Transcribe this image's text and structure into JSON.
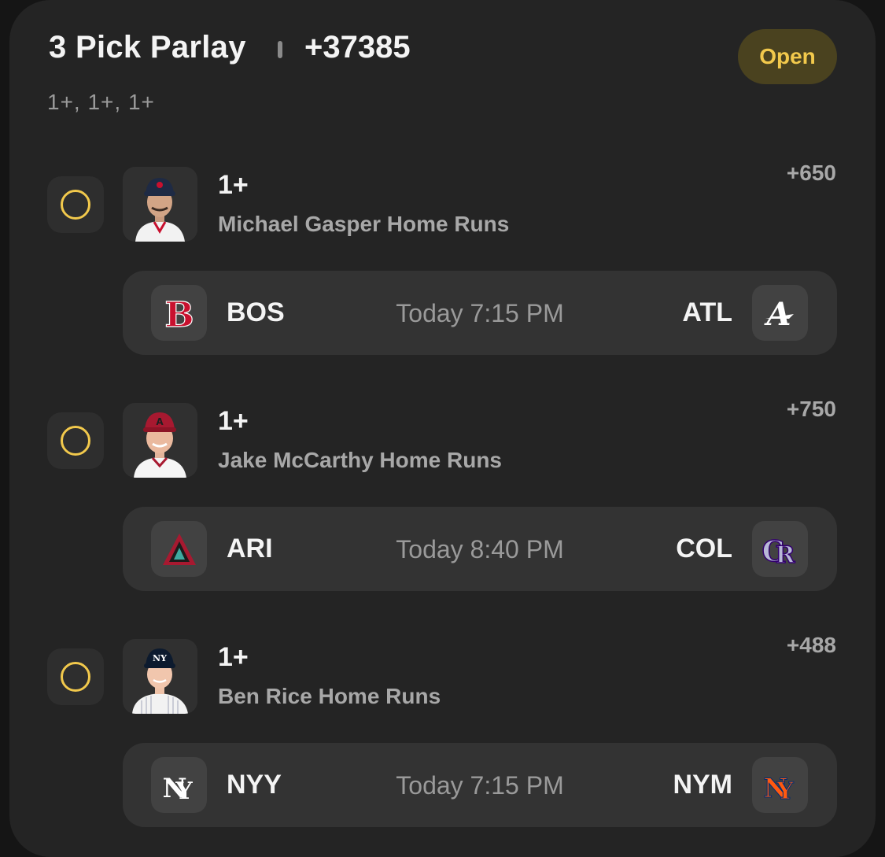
{
  "parlay": {
    "title": "3 Pick Parlay",
    "odds": "+37385",
    "status": "Open",
    "summary": "1+, 1+, 1+"
  },
  "legs": [
    {
      "line": "1+",
      "prop": "Michael Gasper Home Runs",
      "odds": "+650",
      "game": {
        "home": "BOS",
        "away": "ATL",
        "time": "Today 7:15 PM"
      },
      "home_logo_icon": "red-sox-logo-icon",
      "away_logo_icon": "braves-logo-icon",
      "cap_color": "#1e2a44"
    },
    {
      "line": "1+",
      "prop": "Jake McCarthy Home Runs",
      "odds": "+750",
      "game": {
        "home": "ARI",
        "away": "COL",
        "time": "Today 8:40 PM"
      },
      "home_logo_icon": "diamondbacks-logo-icon",
      "away_logo_icon": "rockies-logo-icon",
      "cap_color": "#a71930"
    },
    {
      "line": "1+",
      "prop": "Ben Rice Home Runs",
      "odds": "+488",
      "game": {
        "home": "NYY",
        "away": "NYM",
        "time": "Today 7:15 PM"
      },
      "home_logo_icon": "yankees-logo-icon",
      "away_logo_icon": "mets-logo-icon",
      "cap_color": "#0c1a2e"
    }
  ],
  "colors": {
    "accent_yellow": "#f2c94c",
    "card_bg": "#242424",
    "game_bg": "#333333"
  }
}
